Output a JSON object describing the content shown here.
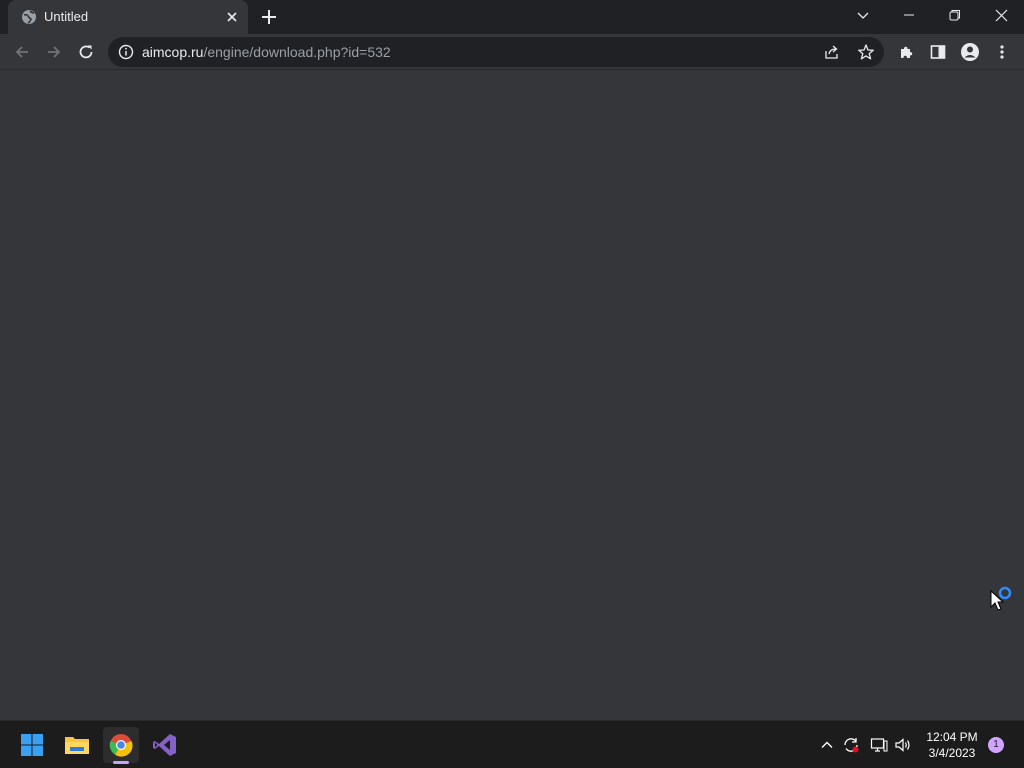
{
  "browser": {
    "tab": {
      "title": "Untitled"
    },
    "address": {
      "host": "aimcop.ru",
      "path": "/engine/download.php?id=532"
    }
  },
  "taskbar": {
    "apps": [
      "windows-start",
      "file-explorer",
      "google-chrome",
      "visual-studio"
    ],
    "clock": {
      "time": "12:04 PM",
      "date": "3/4/2023"
    },
    "notifications": "1"
  },
  "colors": {
    "titlebar": "#202124",
    "page": "#35363a",
    "taskbar": "#1c1c1c",
    "accent": "#c5a3ff"
  }
}
